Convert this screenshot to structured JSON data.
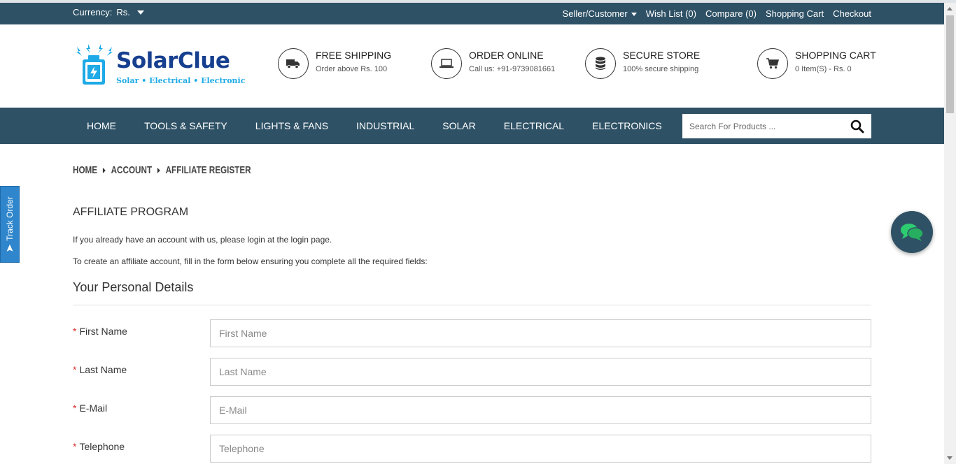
{
  "topbar": {
    "currency_label": "Currency:",
    "currency_value": "Rs.",
    "links": {
      "seller": "Seller/Customer",
      "wishlist": "Wish List (0)",
      "compare": "Compare (0)",
      "cart": "Shopping Cart",
      "checkout": "Checkout"
    }
  },
  "logo": {
    "name": "SolarClue",
    "tagline": "Solar • Electrical • Electronic"
  },
  "features": {
    "shipping": {
      "title": "FREE SHIPPING",
      "subtitle": "Order above Rs. 100",
      "icon": "truck-icon"
    },
    "order": {
      "title": "ORDER ONLINE",
      "subtitle": "Call us: +91-9739081661",
      "icon": "laptop-icon"
    },
    "secure": {
      "title": "SECURE STORE",
      "subtitle": "100% secure shipping",
      "icon": "database-icon"
    },
    "cart": {
      "title": "SHOPPING CART",
      "subtitle": "0 Item(S) - Rs. 0",
      "icon": "cart-icon"
    }
  },
  "nav": {
    "items": [
      "HOME",
      "TOOLS & SAFETY",
      "LIGHTS & FANS",
      "INDUSTRIAL",
      "SOLAR",
      "ELECTRICAL",
      "ELECTRONICS"
    ],
    "search_placeholder": "Search For Products ..."
  },
  "breadcrumb": [
    "HOME",
    "ACCOUNT",
    "AFFILIATE REGISTER"
  ],
  "content": {
    "heading": "AFFILIATE PROGRAM",
    "intro_prefix": "If you already have an account with us, please login at the ",
    "intro_link": "login page",
    "intro_suffix": ".",
    "instructions": "To create an affiliate account, fill in the form below ensuring you complete all the required fields:",
    "section_title": "Your Personal Details"
  },
  "form": {
    "required_mark": "*",
    "fields": [
      {
        "label": "First Name",
        "placeholder": "First Name"
      },
      {
        "label": "Last Name",
        "placeholder": "Last Name"
      },
      {
        "label": "E-Mail",
        "placeholder": "E-Mail"
      },
      {
        "label": "Telephone",
        "placeholder": "Telephone"
      }
    ]
  },
  "track_order": {
    "label": "Track Order"
  },
  "colors": {
    "primary": "#2e5165",
    "logo_dark": "#173f8f",
    "logo_light": "#1eaae6",
    "required": "#d9302c",
    "track_tab": "#2f86cc"
  }
}
